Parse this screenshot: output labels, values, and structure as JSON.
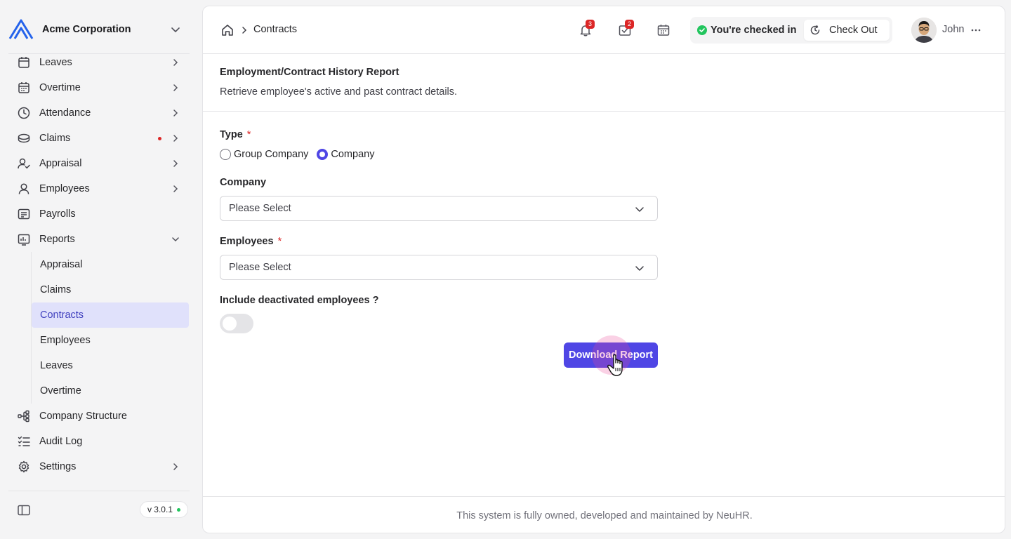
{
  "company": {
    "name": "Acme Corporation"
  },
  "sidebar": {
    "items": [
      {
        "label": "Leaves",
        "icon": "calendar-x-icon"
      },
      {
        "label": "Overtime",
        "icon": "calendar-icon"
      },
      {
        "label": "Attendance",
        "icon": "clock-icon"
      },
      {
        "label": "Claims",
        "icon": "coins-icon",
        "has_alert": true
      },
      {
        "label": "Appraisal",
        "icon": "user-check-icon"
      },
      {
        "label": "Employees",
        "icon": "user-icon"
      },
      {
        "label": "Payrolls",
        "icon": "receipt-icon"
      },
      {
        "label": "Reports",
        "icon": "report-icon",
        "expanded": true
      }
    ],
    "report_subitems": [
      "Appraisal",
      "Claims",
      "Contracts",
      "Employees",
      "Leaves",
      "Overtime"
    ],
    "active_subitem": "Contracts",
    "bottom_items": [
      {
        "label": "Company Structure",
        "icon": "org-chart-icon"
      },
      {
        "label": "Audit Log",
        "icon": "list-check-icon"
      },
      {
        "label": "Settings",
        "icon": "gear-icon"
      }
    ],
    "version": "v 3.0.1"
  },
  "header": {
    "breadcrumb": {
      "current": "Contracts"
    },
    "notifications_count": "3",
    "tasks_count": "2",
    "checkin_status": "You're checked in",
    "checkout_label": "Check Out",
    "user_name": "John"
  },
  "report": {
    "title": "Employment/Contract History Report",
    "description": "Retrieve employee's active and past contract details."
  },
  "form": {
    "type_label": "Type",
    "type_options": [
      "Group Company",
      "Company"
    ],
    "type_selected": "Company",
    "company_label": "Company",
    "company_placeholder": "Please Select",
    "employees_label": "Employees",
    "employees_placeholder": "Please Select",
    "deactivated_label": "Include deactivated employees ?",
    "deactivated_enabled": false,
    "required_mark": "*",
    "download_label": "Download Report"
  },
  "footer": {
    "text": "This system is fully owned, developed and maintained by NeuHR."
  },
  "colors": {
    "accent": "#4f46e5",
    "active_bg": "#e0e1fb",
    "alert": "#dc2626",
    "success": "#22c55e"
  }
}
